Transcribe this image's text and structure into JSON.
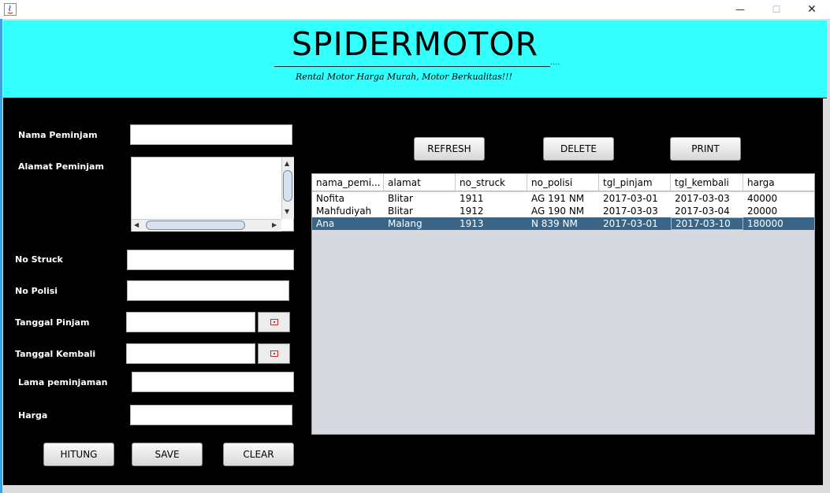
{
  "window": {
    "title_icon": "java-icon",
    "controls": {
      "minimize": "—",
      "maximize": "☐",
      "close": "✕"
    }
  },
  "header": {
    "title": "SPIDERMOTOR",
    "subtitle": "Rental Motor Harga Murah, Motor Berkualitas!!!",
    "dots": "....",
    "background": "#33ffff"
  },
  "form": {
    "nama_label": "Nama Peminjam",
    "nama_value": "",
    "alamat_label": "Alamat Peminjam",
    "alamat_value": "",
    "struck_label": "No Struck",
    "struck_value": "",
    "polisi_label": "No Polisi",
    "polisi_value": "",
    "pinjam_label": "Tanggal Pinjam",
    "pinjam_value": "",
    "kembali_label": "Tanggal Kembali",
    "kembali_value": "",
    "lama_label": "Lama peminjaman",
    "lama_value": "",
    "harga_label": "Harga",
    "harga_value": ""
  },
  "buttons": {
    "hitung": "HITUNG",
    "save": "SAVE",
    "clear": "CLEAR",
    "refresh": "REFRESH",
    "delete": "DELETE",
    "print": "PRINT"
  },
  "table": {
    "columns": [
      "nama_pemi...",
      "alamat",
      "no_struck",
      "no_polisi",
      "tgl_pinjam",
      "tgl_kembali",
      "harga"
    ],
    "rows": [
      [
        "Nofita",
        "Blitar",
        "1911",
        "AG 191 NM",
        "2017-03-01",
        "2017-03-03",
        "40000"
      ],
      [
        "Mahfudiyah",
        "Blitar",
        "1912",
        "AG 190 NM",
        "2017-03-03",
        "2017-03-04",
        "20000"
      ],
      [
        "Ana",
        "Malang",
        "1913",
        "N 839 NM",
        "2017-03-01",
        "2017-03-10",
        "180000"
      ]
    ],
    "selected_row": 2,
    "selected_color": "#3a6587"
  }
}
